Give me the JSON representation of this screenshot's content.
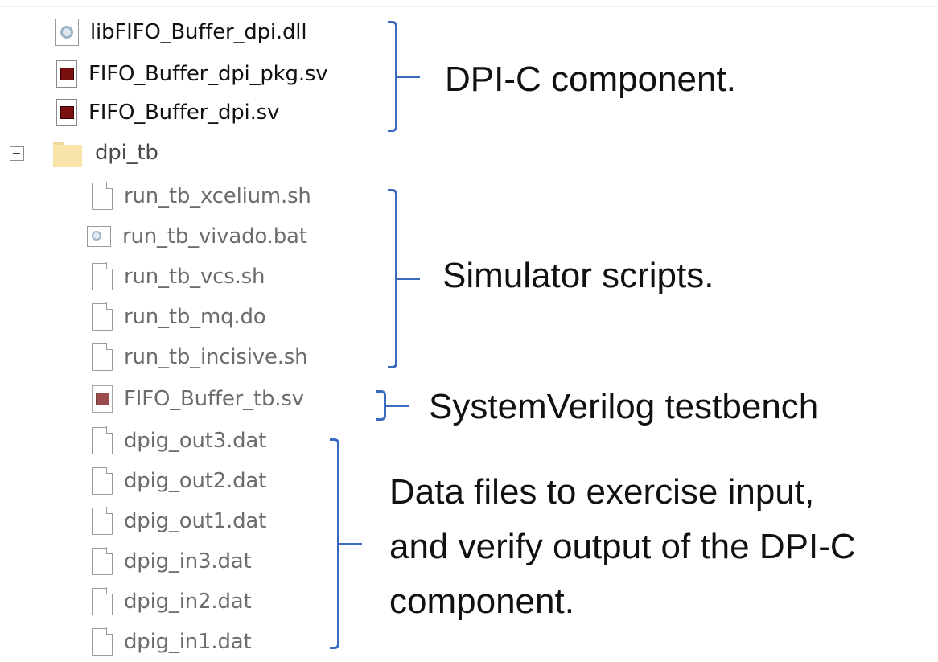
{
  "tree": {
    "top_files": [
      {
        "name": "libFIFO_Buffer_dpi.dll",
        "icon": "dll-gear-icon"
      },
      {
        "name": "FIFO_Buffer_dpi_pkg.sv",
        "icon": "sv-file-icon"
      },
      {
        "name": "FIFO_Buffer_dpi.sv",
        "icon": "sv-file-icon"
      }
    ],
    "folder": {
      "name": "dpi_tb",
      "icon": "folder-icon",
      "expanded": true
    },
    "children": [
      {
        "name": "run_tb_xcelium.sh",
        "icon": "document-icon"
      },
      {
        "name": "run_tb_vivado.bat",
        "icon": "batch-gear-icon"
      },
      {
        "name": "run_tb_vcs.sh",
        "icon": "document-icon"
      },
      {
        "name": "run_tb_mq.do",
        "icon": "document-icon"
      },
      {
        "name": "run_tb_incisive.sh",
        "icon": "document-icon"
      },
      {
        "name": "FIFO_Buffer_tb.sv",
        "icon": "sv-file-icon"
      },
      {
        "name": "dpig_out3.dat",
        "icon": "document-icon"
      },
      {
        "name": "dpig_out2.dat",
        "icon": "document-icon"
      },
      {
        "name": "dpig_out1.dat",
        "icon": "document-icon"
      },
      {
        "name": "dpig_in3.dat",
        "icon": "document-icon"
      },
      {
        "name": "dpig_in2.dat",
        "icon": "document-icon"
      },
      {
        "name": "dpig_in1.dat",
        "icon": "document-icon"
      }
    ]
  },
  "annotations": {
    "dpi_component": "DPI-C component.",
    "simulator_scripts": "Simulator scripts.",
    "testbench": "SystemVerilog testbench",
    "data_files": [
      "Data files to exercise input,",
      "and verify output of the DPI-C",
      "component."
    ]
  },
  "colors": {
    "bracket": "#3b6bc0",
    "folder": "#f8e3a8",
    "sv_icon": "#7a1010"
  }
}
